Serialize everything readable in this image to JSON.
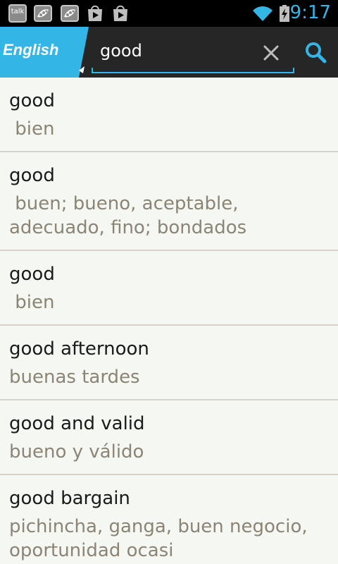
{
  "status_bar": {
    "time": "9:17",
    "notification_icons": [
      "talk-icon",
      "pea-pod-icon",
      "pea-pod-icon",
      "play-store-icon",
      "shopping-bag-icon"
    ],
    "talk_label": "talk"
  },
  "header": {
    "language_label": "English",
    "search": {
      "value": "good",
      "placeholder": ""
    },
    "accent_color": "#33b5e5"
  },
  "results": [
    {
      "term": "good",
      "translation": " bien"
    },
    {
      "term": "good",
      "translation": " buen; bueno, aceptable, adecuado, fino; bondados"
    },
    {
      "term": "good",
      "translation": " bien"
    },
    {
      "term": "good afternoon",
      "translation": "buenas tardes"
    },
    {
      "term": "good and valid",
      "translation": "bueno y válido"
    },
    {
      "term": "good bargain",
      "translation": "pichincha, ganga, buen negocio, oportunidad ocasi"
    }
  ]
}
